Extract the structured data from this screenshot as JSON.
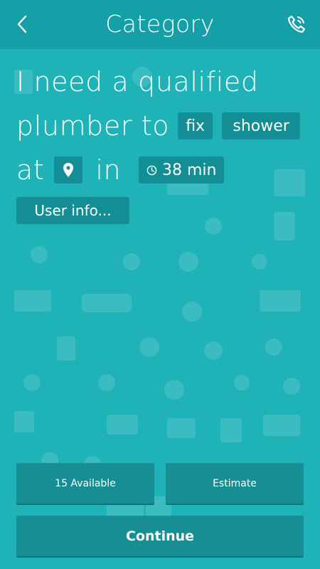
{
  "header": {
    "title": "Category",
    "back_icon": "chevron-left-icon",
    "call_icon": "phone-icon"
  },
  "request": {
    "line1": "I need a qualified",
    "line2_prefix": "plumber to",
    "action": "fix",
    "object": "shower",
    "line3_at": "at",
    "location_icon": "map-pin-icon",
    "line3_in": "in",
    "eta_icon": "clock-icon",
    "eta": "38 min",
    "user_info": "User info..."
  },
  "buttons": {
    "available": "15 Available",
    "estimate": "Estimate",
    "continue": "Continue"
  },
  "colors": {
    "background": "#1fb3b8",
    "header": "#14a0a6",
    "chip": "#138e94",
    "button": "#168e93"
  }
}
